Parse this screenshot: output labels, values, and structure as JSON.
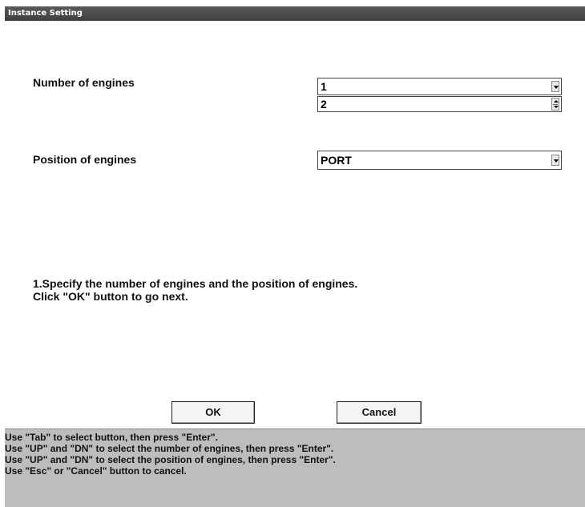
{
  "window": {
    "title": "Instance Setting"
  },
  "form": {
    "engines_label": "Number of engines",
    "engines_select_value": "1",
    "engines_spin_value": "2",
    "position_label": "Position of engines",
    "position_select_value": "PORT"
  },
  "instructions": {
    "line1": "1.Specify the number of engines and the position of engines.",
    "line2": "Click \"OK\" button to go next."
  },
  "buttons": {
    "ok": "OK",
    "cancel": "Cancel"
  },
  "status": {
    "lines": [
      "Use \"Tab\" to select button, then press \"Enter\".",
      "Use \"UP\" and \"DN\" to select the number of engines, then press \"Enter\".",
      "Use \"UP\" and \"DN\" to select the position of engines, then press \"Enter\".",
      "Use \"Esc\" or \"Cancel\" button to cancel."
    ]
  }
}
